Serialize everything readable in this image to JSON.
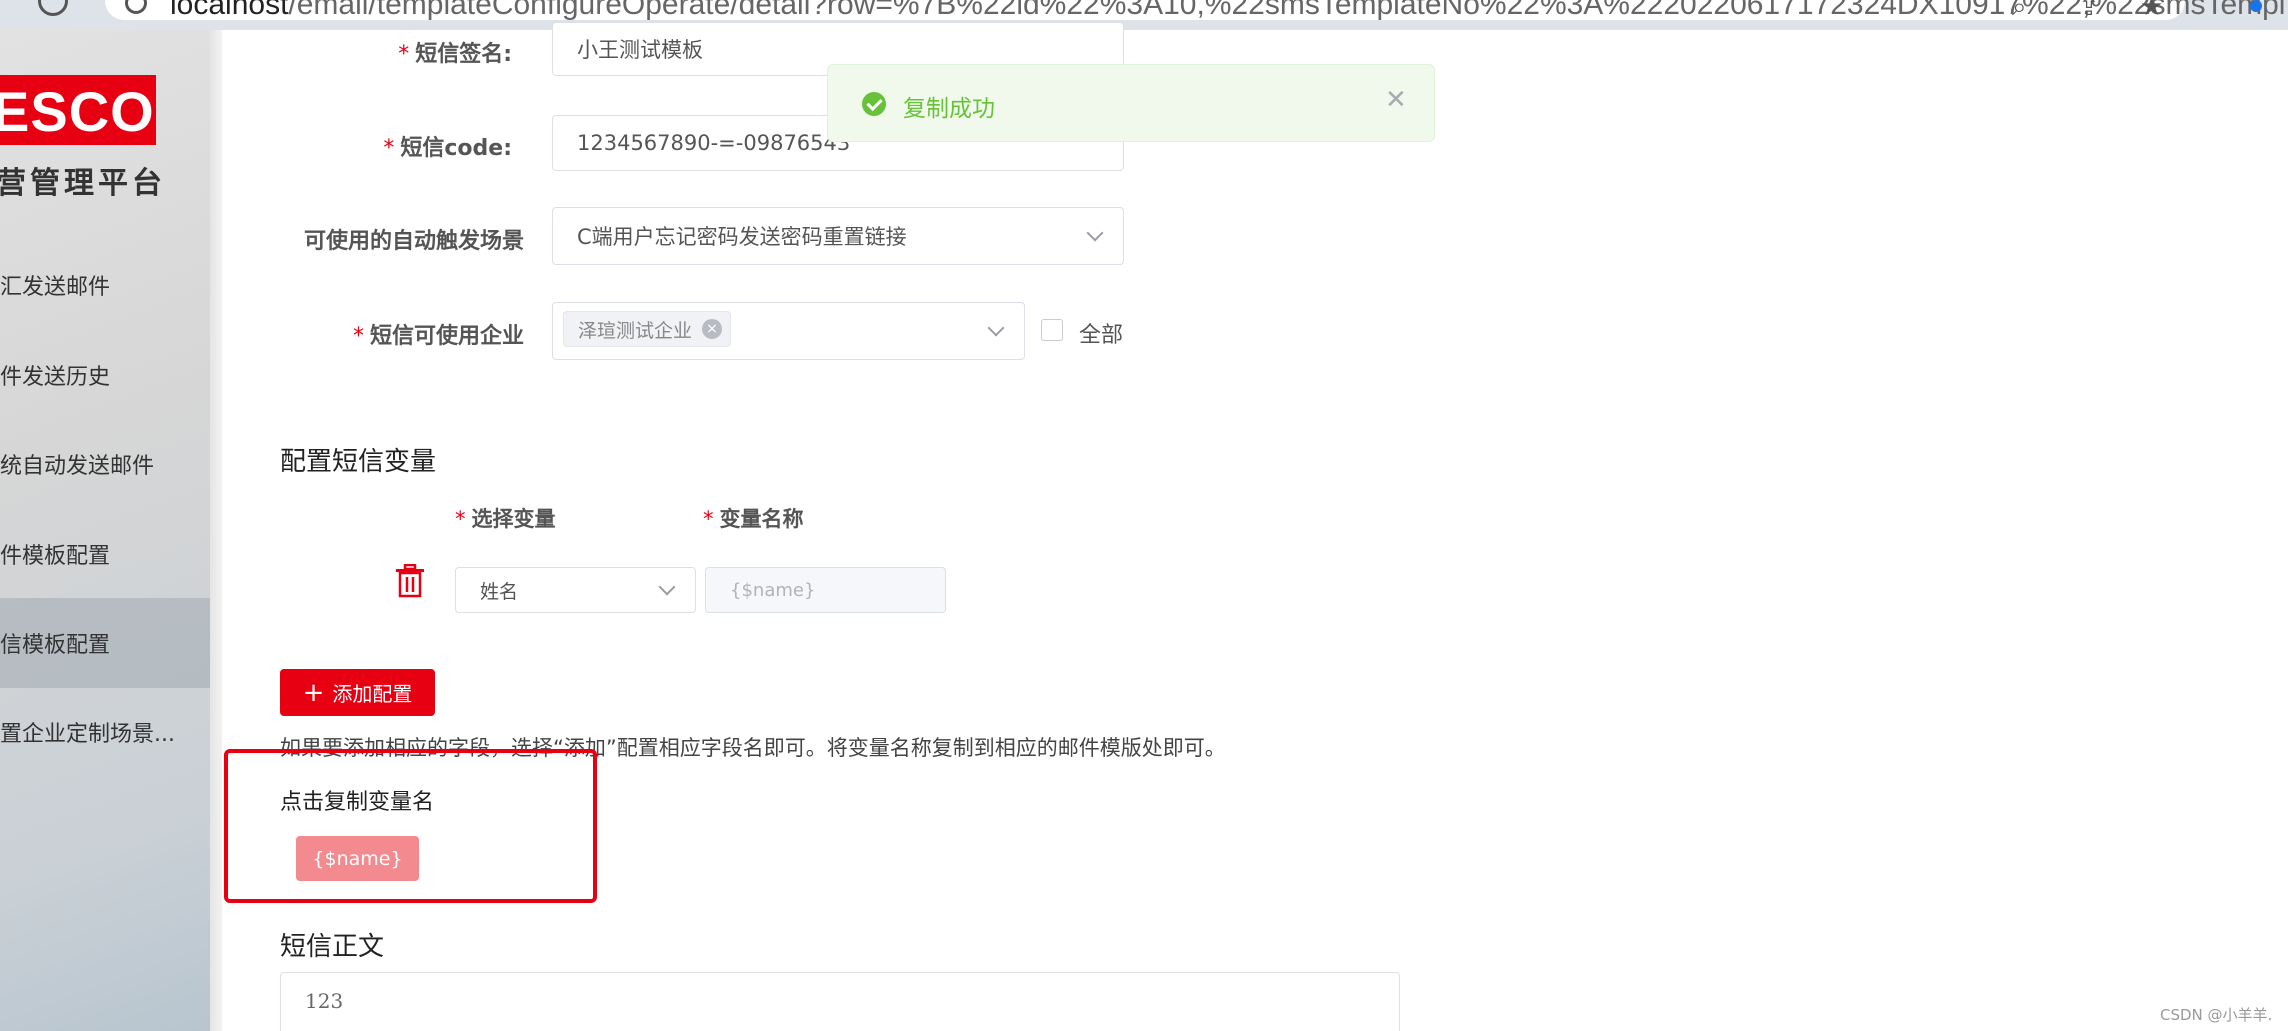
{
  "browser": {
    "url_host": "localhost",
    "url_path": "/email/templateConfigureOperate/detail?row=%7B%22id%22%3A10,%22smsTemplateNo%22%3A%2220220617172324DX10917%22,%22smsTempl..."
  },
  "sidebar": {
    "logo": "ESCO",
    "platform": "营管理平台",
    "items": [
      {
        "label": "汇发送邮件",
        "active": false
      },
      {
        "label": "件发送历史",
        "active": false
      },
      {
        "label": "统自动发送邮件",
        "active": false
      },
      {
        "label": "件模板配置",
        "active": false
      },
      {
        "label": "信模板配置",
        "active": true
      },
      {
        "label": "置企业定制场景...",
        "active": false
      }
    ]
  },
  "form": {
    "sms_sign": {
      "label": "短信签名:",
      "value": "小王测试模板"
    },
    "sms_code": {
      "label": "短信code:",
      "value": "1234567890-=-09876543"
    },
    "trigger_scene": {
      "label": "可使用的自动触发场景",
      "value": "C端用户忘记密码发送密码重置链接"
    },
    "companies": {
      "label": "短信可使用企业",
      "tag": "泽瑄测试企业",
      "all_label": "全部"
    }
  },
  "variables": {
    "section_title": "配置短信变量",
    "col_select": "选择变量",
    "col_name": "变量名称",
    "rows": [
      {
        "select": "姓名",
        "name_placeholder": "{$name}"
      }
    ],
    "add_button": "添加配置",
    "hint": "如果要添加相应的字段，选择“添加”配置相应字段名即可。将变量名称复制到相应的邮件模版处即可。",
    "copy_title": "点击复制变量名",
    "chips": [
      "{$name}"
    ]
  },
  "body_section": {
    "title": "短信正文",
    "content": "123"
  },
  "toast": {
    "message": "复制成功"
  },
  "watermark": "CSDN @小羊羊.",
  "colors": {
    "brand": "#e60012",
    "success": "#67c23a"
  }
}
